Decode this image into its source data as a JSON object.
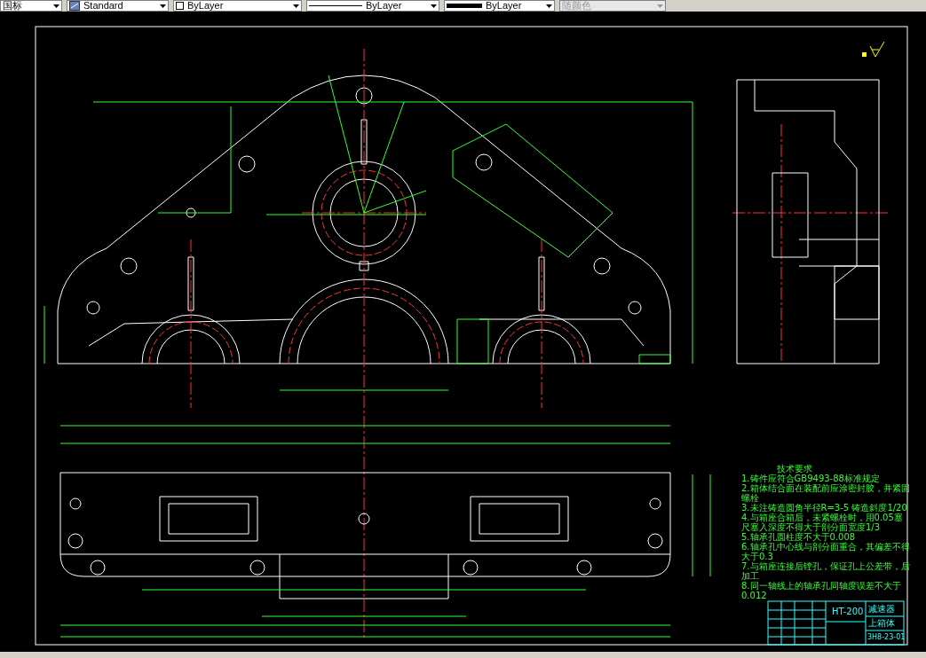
{
  "toolbar": {
    "controls": [
      {
        "kind": "combo",
        "value": "国标",
        "disabled": false
      },
      {
        "kind": "style",
        "value": "Standard",
        "disabled": false
      },
      {
        "kind": "color",
        "value": "ByLayer",
        "disabled": false
      },
      {
        "kind": "linetype",
        "value": "ByLayer",
        "disabled": false
      },
      {
        "kind": "lineweight",
        "value": "ByLayer",
        "disabled": false
      },
      {
        "kind": "combo",
        "value": "随颜色",
        "disabled": true
      }
    ]
  },
  "drawing": {
    "notes": {
      "title": "技术要求",
      "lines": [
        "1.铸件应符合GB9493-88标准规定",
        "2.箱体结合面在装配前应涂密封胶，并紧固螺栓",
        "3.未注铸造圆角半径R=3-5  铸造斜度1/20",
        "4.与箱座合箱后，未紧螺栓时，用0.05塞尺塞入深度不得大于剖分面宽度1/3",
        "5.轴承孔圆柱度不大于0.008",
        "6.轴承孔中心线与剖分面重合，其偏差不得大于0.3",
        "7.与箱座连接后镗孔，保证孔上公差带，后加工",
        "8.同一轴线上的轴承孔同轴度误差不大于0.012"
      ]
    },
    "title_block": {
      "material": "HT-200",
      "product": "减速器",
      "part": "上箱体",
      "drawing_no": "3H8-23-01"
    }
  }
}
